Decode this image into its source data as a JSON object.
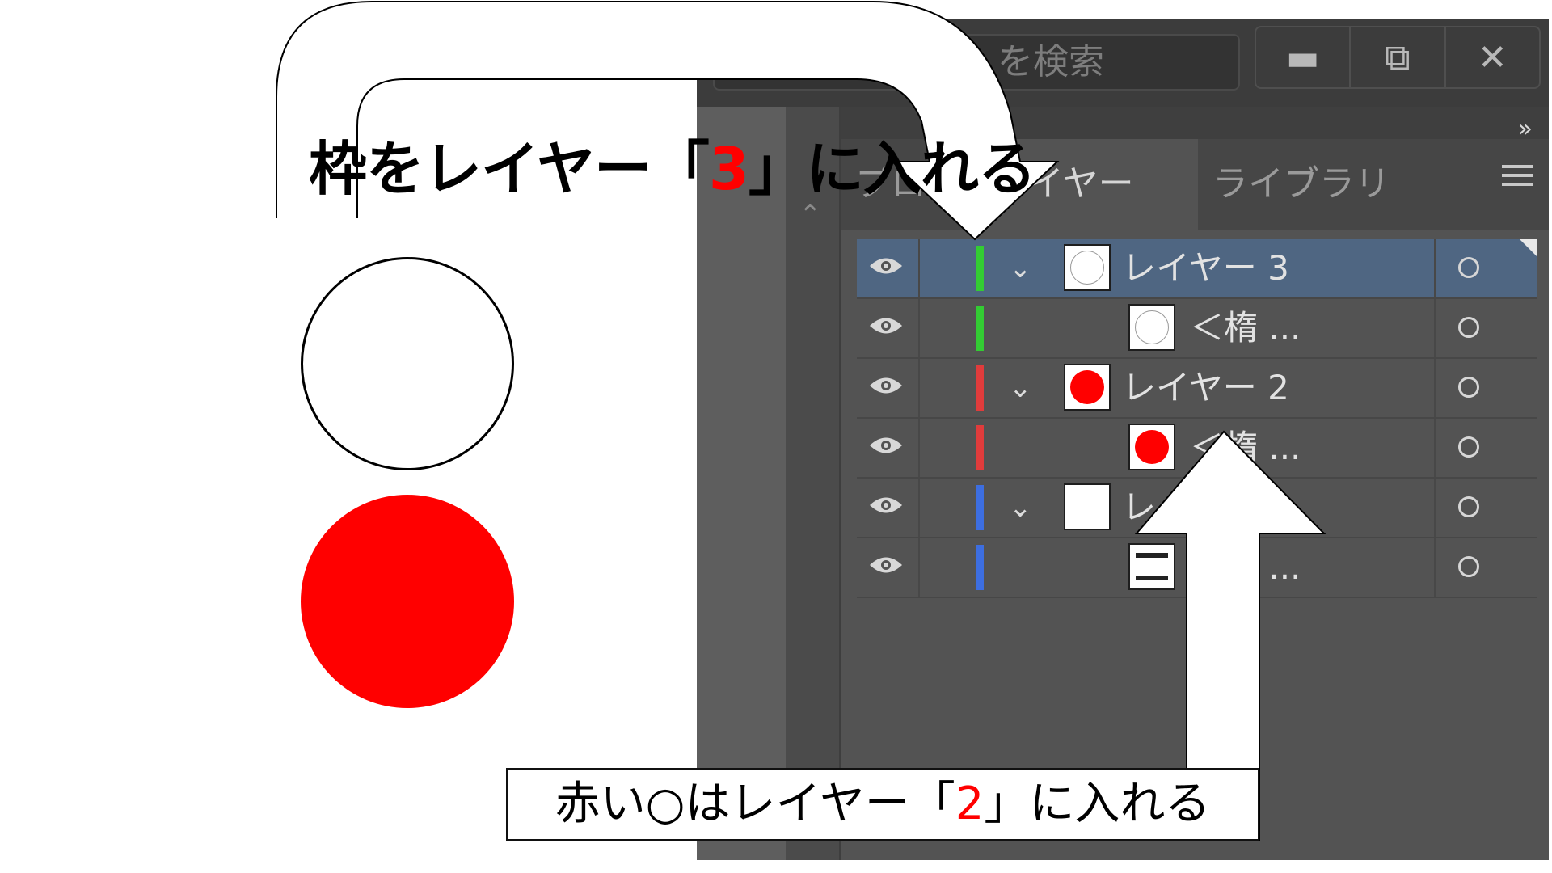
{
  "search": {
    "placeholder": "を検索"
  },
  "window": {
    "minimize": "▬",
    "restore": "⧉",
    "close": "✕"
  },
  "panel": {
    "collapse_icon": "»",
    "tabs": [
      {
        "label": "プロパティ",
        "active": false
      },
      {
        "label": "レイヤー",
        "active": true
      },
      {
        "label": "ライブラリ",
        "active": false
      }
    ],
    "menu_icon": "hamburger-icon"
  },
  "layers": [
    {
      "name": "レイヤー 3",
      "level": 1,
      "color": "#33cc33",
      "expanded": true,
      "selected": true,
      "thumb": "white-circle"
    },
    {
      "name": "＜楕 ...",
      "level": 2,
      "color": "#33cc33",
      "thumb": "white-circle"
    },
    {
      "name": "レイヤー 2",
      "level": 1,
      "color": "#e03c3c",
      "expanded": true,
      "thumb": "red-circle"
    },
    {
      "name": "＜楕 ...",
      "level": 2,
      "color": "#e03c3c",
      "thumb": "red-circle"
    },
    {
      "name": "レイヤー 1",
      "level": 1,
      "color": "#3d6ee0",
      "expanded": true,
      "thumb": "blank"
    },
    {
      "name": "＜長 ...",
      "level": 2,
      "color": "#3d6ee0",
      "thumb": "frame"
    }
  ],
  "captions": {
    "top_prefix": "枠をレイヤー「",
    "top_num": "3",
    "top_suffix": "」に入れる",
    "bottom_prefix": "赤い○はレイヤー「",
    "bottom_num": "2",
    "bottom_suffix": "」に入れる"
  },
  "colors": {
    "accent_red": "#ff0000",
    "panel_bg": "#535353",
    "selected_row": "#4f6682"
  }
}
